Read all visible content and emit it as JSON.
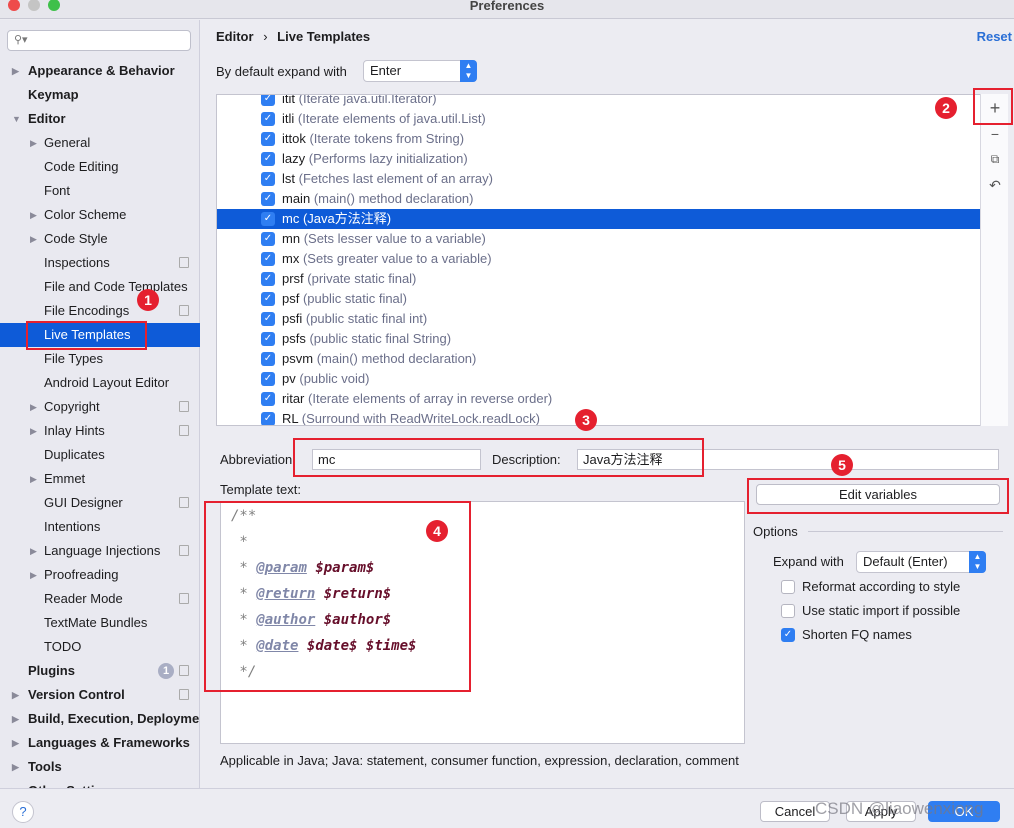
{
  "window": {
    "title": "Preferences"
  },
  "sidebar": {
    "search_placeholder": "",
    "items": [
      {
        "label": "Appearance & Behavior",
        "level": "top",
        "expandable": true
      },
      {
        "label": "Keymap",
        "level": "top"
      },
      {
        "label": "Editor",
        "level": "top",
        "expanded": true
      },
      {
        "label": "General",
        "level": "sub",
        "expandable": true
      },
      {
        "label": "Code Editing",
        "level": "sub"
      },
      {
        "label": "Font",
        "level": "sub"
      },
      {
        "label": "Color Scheme",
        "level": "sub",
        "expandable": true
      },
      {
        "label": "Code Style",
        "level": "sub",
        "expandable": true
      },
      {
        "label": "Inspections",
        "level": "sub",
        "copy": true
      },
      {
        "label": "File and Code Templates",
        "level": "sub"
      },
      {
        "label": "File Encodings",
        "level": "sub",
        "copy": true
      },
      {
        "label": "Live Templates",
        "level": "sub",
        "selected": true
      },
      {
        "label": "File Types",
        "level": "sub"
      },
      {
        "label": "Android Layout Editor",
        "level": "sub"
      },
      {
        "label": "Copyright",
        "level": "sub",
        "expandable": true,
        "copy": true
      },
      {
        "label": "Inlay Hints",
        "level": "sub",
        "expandable": true,
        "copy": true
      },
      {
        "label": "Duplicates",
        "level": "sub"
      },
      {
        "label": "Emmet",
        "level": "sub",
        "expandable": true
      },
      {
        "label": "GUI Designer",
        "level": "sub",
        "copy": true
      },
      {
        "label": "Intentions",
        "level": "sub"
      },
      {
        "label": "Language Injections",
        "level": "sub",
        "expandable": true,
        "copy": true
      },
      {
        "label": "Proofreading",
        "level": "sub",
        "expandable": true
      },
      {
        "label": "Reader Mode",
        "level": "sub",
        "copy": true
      },
      {
        "label": "TextMate Bundles",
        "level": "sub"
      },
      {
        "label": "TODO",
        "level": "sub"
      },
      {
        "label": "Plugins",
        "level": "top",
        "badge": "1",
        "copy": true
      },
      {
        "label": "Version Control",
        "level": "top",
        "expandable": true,
        "copy": true
      },
      {
        "label": "Build, Execution, Deployment",
        "level": "top",
        "expandable": true
      },
      {
        "label": "Languages & Frameworks",
        "level": "top",
        "expandable": true
      },
      {
        "label": "Tools",
        "level": "top",
        "expandable": true
      },
      {
        "label": "Other Settings",
        "level": "top",
        "expandable": true
      }
    ]
  },
  "header": {
    "breadcrumb": [
      "Editor",
      "Live Templates"
    ],
    "reset": "Reset"
  },
  "expand": {
    "label": "By default expand with",
    "value": "Enter"
  },
  "templates": [
    {
      "abbr": "itit",
      "desc": "(Iterate java.util.Iterator)"
    },
    {
      "abbr": "itli",
      "desc": "(Iterate elements of java.util.List)"
    },
    {
      "abbr": "ittok",
      "desc": "(Iterate tokens from String)"
    },
    {
      "abbr": "lazy",
      "desc": "(Performs lazy initialization)"
    },
    {
      "abbr": "lst",
      "desc": "(Fetches last element of an array)"
    },
    {
      "abbr": "main",
      "desc": "(main() method declaration)"
    },
    {
      "abbr": "mc",
      "desc": "(Java方法注释)",
      "selected": true
    },
    {
      "abbr": "mn",
      "desc": "(Sets lesser value to a variable)"
    },
    {
      "abbr": "mx",
      "desc": "(Sets greater value to a variable)"
    },
    {
      "abbr": "prsf",
      "desc": "(private static final)"
    },
    {
      "abbr": "psf",
      "desc": "(public static final)"
    },
    {
      "abbr": "psfi",
      "desc": "(public static final int)"
    },
    {
      "abbr": "psfs",
      "desc": "(public static final String)"
    },
    {
      "abbr": "psvm",
      "desc": "(main() method declaration)"
    },
    {
      "abbr": "pv",
      "desc": "(public void)"
    },
    {
      "abbr": "ritar",
      "desc": "(Iterate elements of array in reverse order)"
    },
    {
      "abbr": "RL",
      "desc": "(Surround with ReadWriteLock.readLock)"
    }
  ],
  "tools": {
    "add": "+",
    "remove": "−",
    "copy": "⧉",
    "revert": "↶"
  },
  "form": {
    "abbr_label": "Abbreviation:",
    "abbr_value": "mc",
    "desc_label": "Description:",
    "desc_value": "Java方法注释",
    "template_label": "Template text:",
    "edit_variables": "Edit variables"
  },
  "code": [
    [
      {
        "t": "/**",
        "c": "cm"
      }
    ],
    [
      {
        "t": " *",
        "c": "cm"
      }
    ],
    [
      {
        "t": " * ",
        "c": "cm"
      },
      {
        "t": "@param",
        "c": "tag"
      },
      {
        "t": " ",
        "c": "cm"
      },
      {
        "t": "$param$",
        "c": "var"
      }
    ],
    [
      {
        "t": " * ",
        "c": "cm"
      },
      {
        "t": "@return",
        "c": "tag"
      },
      {
        "t": " ",
        "c": "cm"
      },
      {
        "t": "$return$",
        "c": "var"
      }
    ],
    [
      {
        "t": " * ",
        "c": "cm"
      },
      {
        "t": "@author",
        "c": "tag"
      },
      {
        "t": " ",
        "c": "cm"
      },
      {
        "t": "$author$",
        "c": "var"
      }
    ],
    [
      {
        "t": " * ",
        "c": "cm"
      },
      {
        "t": "@date",
        "c": "tag"
      },
      {
        "t": " ",
        "c": "cm"
      },
      {
        "t": "$date$ $time$",
        "c": "var"
      }
    ],
    [
      {
        "t": " */",
        "c": "cm"
      }
    ]
  ],
  "applicable": "Applicable in Java; Java: statement, consumer function, expression, declaration, comment",
  "options": {
    "title": "Options",
    "expand_label": "Expand with",
    "expand_value": "Default (Enter)",
    "checks": [
      {
        "label": "Reformat according to style",
        "checked": false
      },
      {
        "label": "Use static import if possible",
        "checked": false
      },
      {
        "label": "Shorten FQ names",
        "checked": true
      }
    ]
  },
  "annotations": [
    "1",
    "2",
    "3",
    "4",
    "5"
  ],
  "footer": {
    "help": "?",
    "cancel": "Cancel",
    "apply": "Apply",
    "ok": "OK",
    "watermark": "CSDN @liaowenxiong"
  },
  "colors": {
    "accent": "#0E5BD8",
    "annotation": "#E5202F"
  }
}
